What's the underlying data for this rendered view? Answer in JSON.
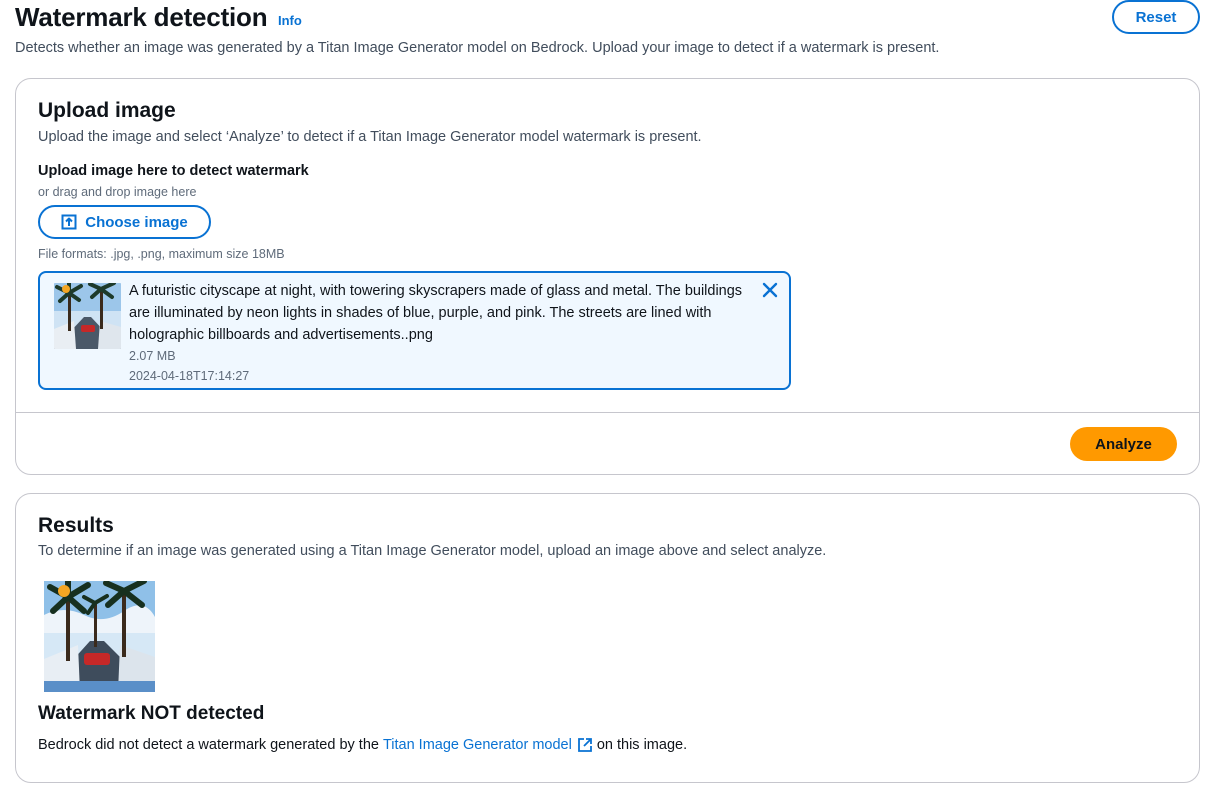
{
  "header": {
    "title": "Watermark detection",
    "info_label": "Info",
    "description": "Detects whether an image was generated by a Titan Image Generator model on Bedrock. Upload your image to detect if a watermark is present.",
    "reset_label": "Reset"
  },
  "upload": {
    "title": "Upload image",
    "description": "Upload the image and select ‘Analyze’ to detect if a Titan Image Generator model watermark is present.",
    "field_label": "Upload image here to detect watermark",
    "field_sub": "or drag and drop image here",
    "choose_label": "Choose image",
    "formats": "File formats: .jpg, .png, maximum size 18MB",
    "file": {
      "name": "A futuristic cityscape at night, with towering skyscrapers made of glass and metal. The buildings are illuminated by neon lights in shades of blue, purple, and pink. The streets are lined with holographic billboards and advertisements..png",
      "size": "2.07 MB",
      "date": "2024-04-18T17:14:27"
    },
    "analyze_label": "Analyze"
  },
  "results": {
    "title": "Results",
    "description": "To determine if an image was generated using a Titan Image Generator model, upload an image above and select analyze.",
    "status_heading": "Watermark NOT detected",
    "text_before": "Bedrock did not detect a watermark generated by the",
    "link_label": "Titan Image Generator model",
    "text_after": "on this image."
  },
  "colors": {
    "accent": "#0972d3",
    "primary_button": "#ff9900",
    "token_background": "#f0f8ff"
  },
  "icons": {
    "upload": "upload-icon",
    "dismiss": "close-icon",
    "external": "external-link-icon"
  }
}
